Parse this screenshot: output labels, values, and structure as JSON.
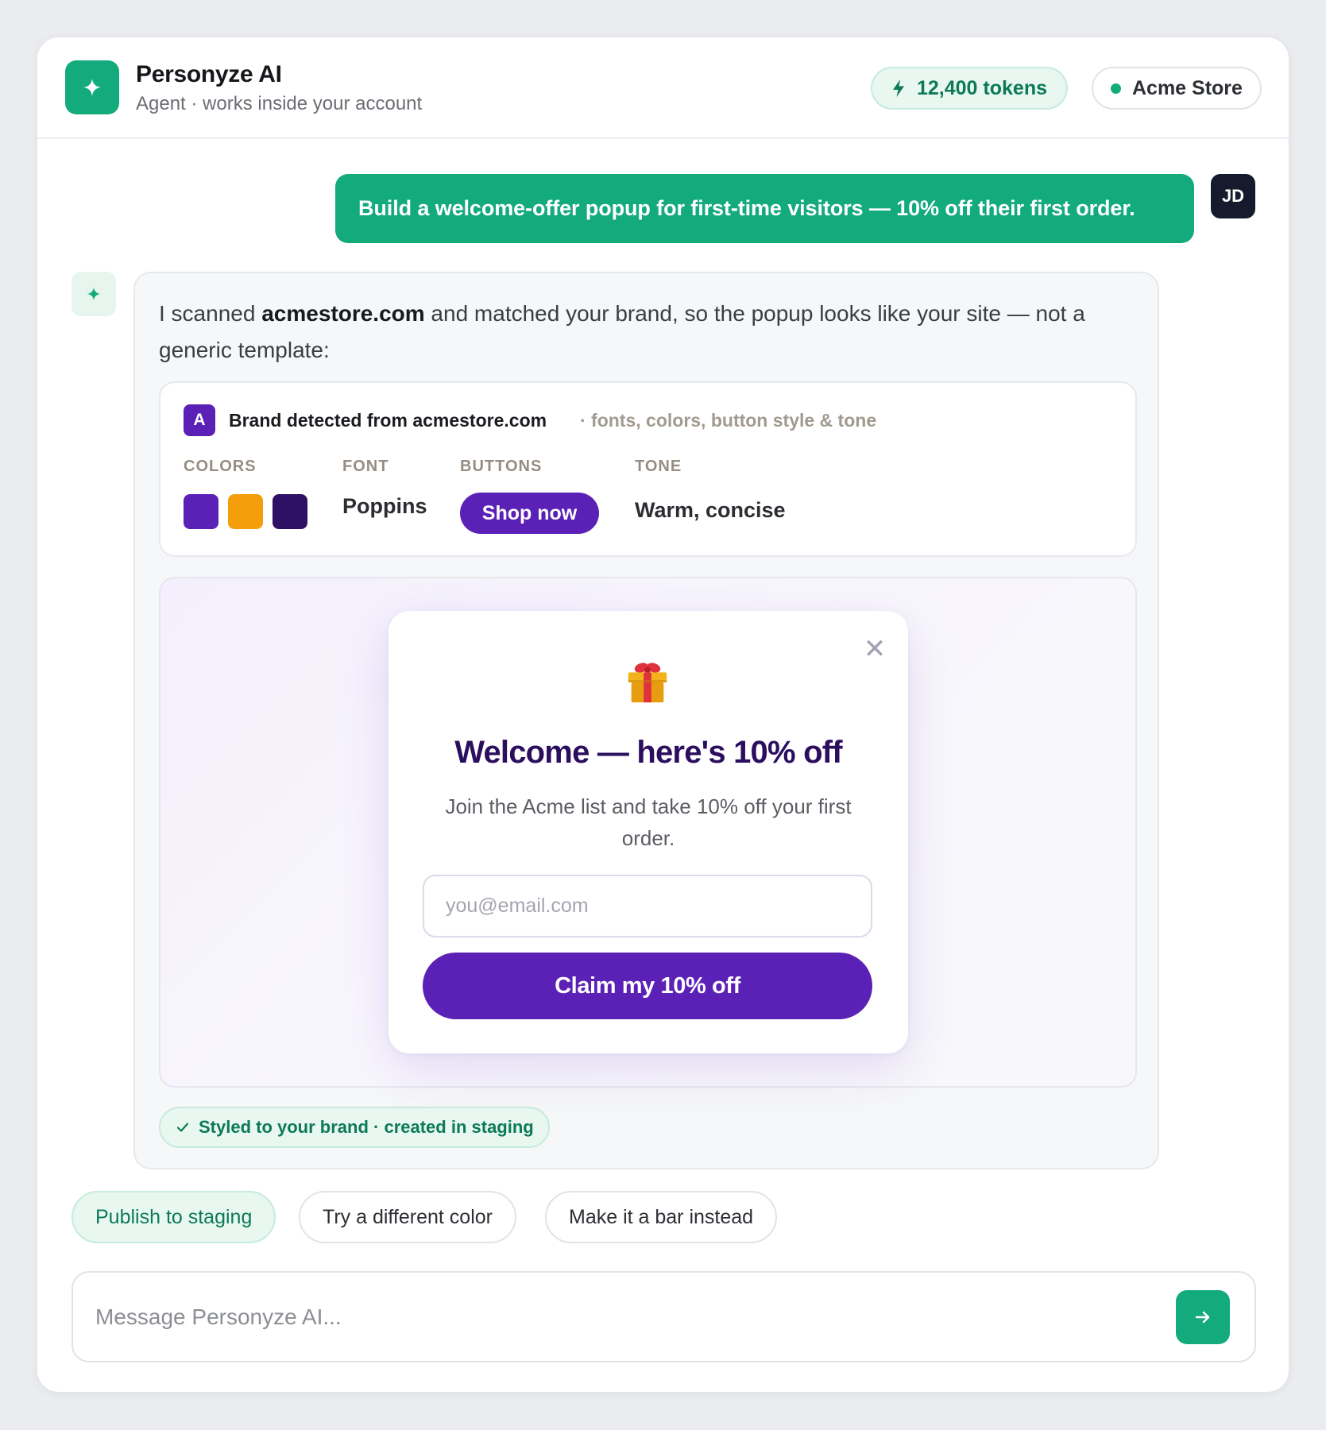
{
  "header": {
    "title": "Personyze AI",
    "subtitle": "Agent · works inside your account",
    "tokens": "12,400 tokens",
    "store": "Acme Store",
    "colors": {
      "brand": "#14ab7c",
      "status_dot": "#14ab7c"
    }
  },
  "conversation": {
    "user": {
      "avatar_initials": "JD",
      "message": "Build a welcome-offer popup for first-time visitors — 10% off their first order."
    },
    "assistant": {
      "intro_prefix": "I scanned ",
      "intro_domain": "acmestore.com",
      "intro_suffix": " and matched your brand, so the popup looks like your site — not a generic template:",
      "brand_card": {
        "badge_letter": "A",
        "title": "Brand detected from acmestore.com",
        "meta": "· fonts, colors, button style & tone",
        "colors_label": "COLORS",
        "font_label": "FONT",
        "buttons_label": "BUTTONS",
        "tone_label": "TONE",
        "swatches": [
          "#5b21b6",
          "#f59e0b",
          "#2e1065"
        ],
        "font_value": "Poppins",
        "button_sample": "Shop now",
        "tone_value": "Warm, concise"
      },
      "popup_preview": {
        "close_icon": "close-icon",
        "icon": "gift-icon",
        "title": "Welcome — here's 10% off",
        "body": "Join the Acme list and take 10% off your first order.",
        "email_placeholder": "you@email.com",
        "cta": "Claim my 10% off"
      },
      "status_badge": "Styled to your brand · created in staging"
    }
  },
  "suggestions": [
    "Publish to staging",
    "Try a different color",
    "Make it a bar instead"
  ],
  "composer": {
    "placeholder": "Message Personyze AI..."
  }
}
